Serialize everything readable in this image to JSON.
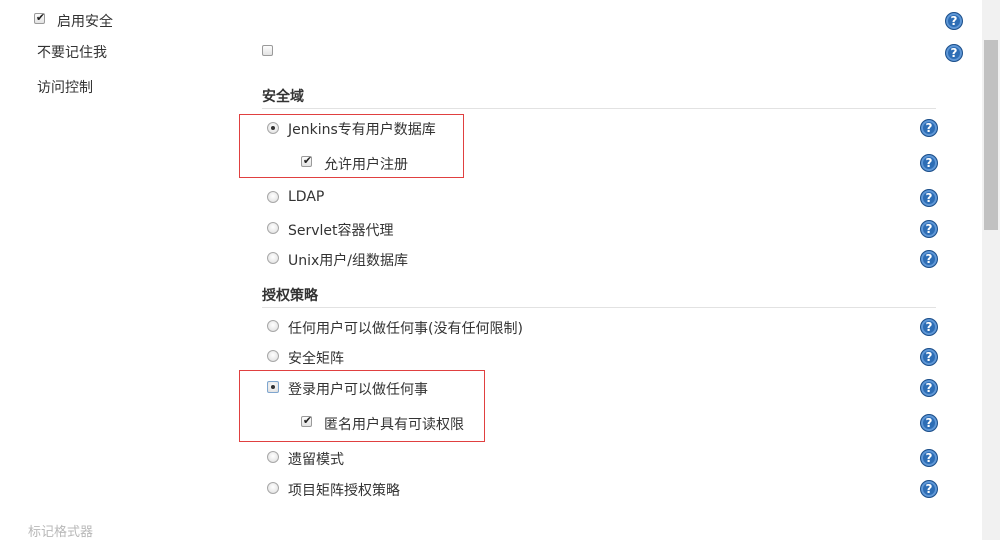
{
  "enable_security": {
    "label": "启用安全",
    "checked": true
  },
  "remember_me": {
    "label": "不要记住我",
    "checked": false
  },
  "access_control": {
    "label": "访问控制"
  },
  "security_realm": {
    "title": "安全域",
    "options": [
      {
        "label": "Jenkins专有用户数据库",
        "selected": true
      },
      {
        "label": "LDAP",
        "selected": false
      },
      {
        "label": "Servlet容器代理",
        "selected": false
      },
      {
        "label": "Unix用户/组数据库",
        "selected": false
      }
    ],
    "allow_signup": {
      "label": "允许用户注册",
      "checked": true
    }
  },
  "authorization": {
    "title": "授权策略",
    "options": [
      {
        "label": "任何用户可以做任何事(没有任何限制)",
        "selected": false
      },
      {
        "label": "安全矩阵",
        "selected": false
      },
      {
        "label": "登录用户可以做任何事",
        "selected": true
      },
      {
        "label": "遗留模式",
        "selected": false
      },
      {
        "label": "项目矩阵授权策略",
        "selected": false
      }
    ],
    "anonymous_read": {
      "label": "匿名用户具有可读权限",
      "checked": true
    }
  },
  "markup_formatter": {
    "label": "标记格式器"
  },
  "icons": {
    "help": "help-question-icon",
    "check": "✔"
  },
  "colors": {
    "highlight": "#e04040",
    "help_blue": "#2d6db5"
  }
}
